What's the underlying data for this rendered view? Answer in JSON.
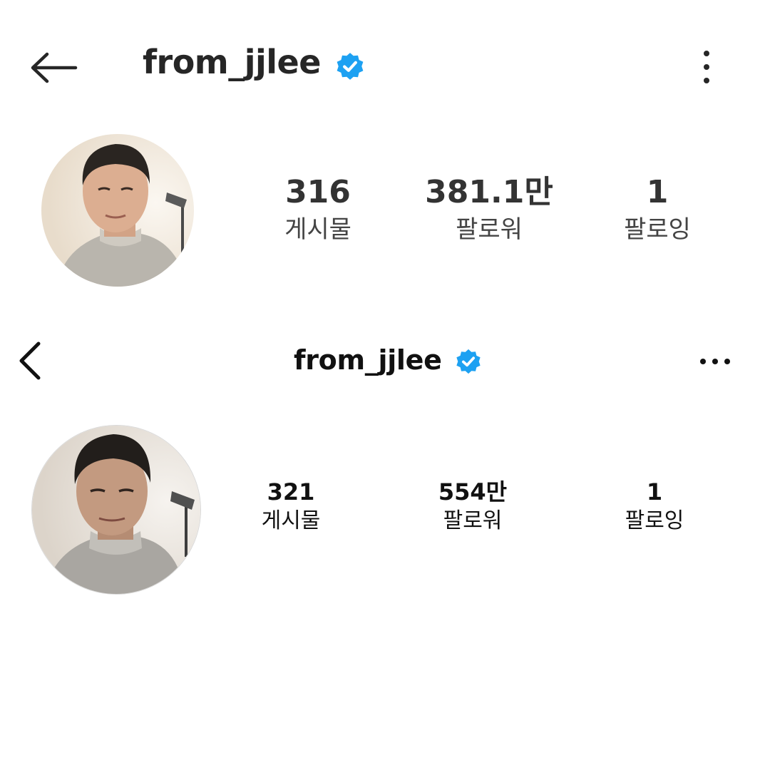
{
  "screenshot_top": {
    "header": {
      "username": "from_jjlee",
      "back_icon": "arrow-left-icon",
      "verified_icon": "verified-badge-icon",
      "more_icon": "kebab-vertical-icon"
    },
    "profile": {
      "avatar": "profile-photo"
    },
    "stats": [
      {
        "value": "316",
        "label": "게시물"
      },
      {
        "value": "381.1만",
        "label": "팔로워"
      },
      {
        "value": "1",
        "label": "팔로잉"
      }
    ]
  },
  "screenshot_bottom": {
    "header": {
      "username": "from_jjlee",
      "back_icon": "chevron-left-icon",
      "verified_icon": "verified-badge-icon",
      "more_icon": "ellipsis-horizontal-icon"
    },
    "profile": {
      "avatar": "profile-photo"
    },
    "stats": [
      {
        "value": "321",
        "label": "게시물"
      },
      {
        "value": "554만",
        "label": "팔로워"
      },
      {
        "value": "1",
        "label": "팔로잉"
      }
    ]
  },
  "colors": {
    "verified": "#1da1f2",
    "text": "#262626",
    "background": "#ffffff"
  }
}
